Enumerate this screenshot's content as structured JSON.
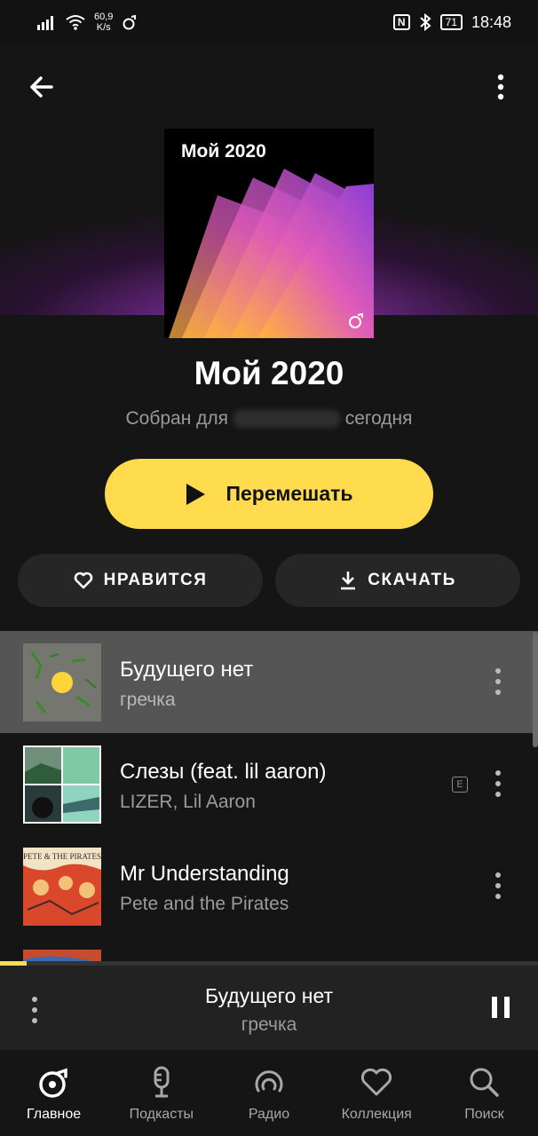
{
  "status_bar": {
    "speed_value": "60,9",
    "speed_unit": "K/s",
    "battery": "71",
    "time": "18:48",
    "nfc": "N"
  },
  "playlist": {
    "cover_title": "Мой 2020",
    "title": "Мой 2020",
    "subtitle_prefix": "Собран для",
    "subtitle_suffix": "сегодня",
    "shuffle_label": "Перемешать",
    "like_label": "НРАВИТСЯ",
    "download_label": "СКАЧАТЬ"
  },
  "tracks": [
    {
      "title": "Будущего нет",
      "artist": "гречка",
      "explicit": false,
      "active": true
    },
    {
      "title": "Слезы (feat. lil aaron)",
      "artist": "LIZER, Lil Aaron",
      "explicit": true,
      "explicit_label": "E"
    },
    {
      "title": "Mr Understanding",
      "artist": "Pete and the Pirates",
      "explicit": false
    }
  ],
  "album_art_text": {
    "track3": "PETE & THE PIRATES"
  },
  "player": {
    "title": "Будущего нет",
    "artist": "гречка",
    "progress": 0.05
  },
  "nav": [
    {
      "label": "Главное",
      "icon": "home-music-icon",
      "active": true
    },
    {
      "label": "Подкасты",
      "icon": "microphone-icon"
    },
    {
      "label": "Радио",
      "icon": "radio-icon"
    },
    {
      "label": "Коллекция",
      "icon": "heart-icon"
    },
    {
      "label": "Поиск",
      "icon": "search-icon"
    }
  ],
  "colors": {
    "accent": "#ffdb4d",
    "background": "#151515",
    "active_row": "#555555",
    "header_glow": "#8f3ab5"
  }
}
